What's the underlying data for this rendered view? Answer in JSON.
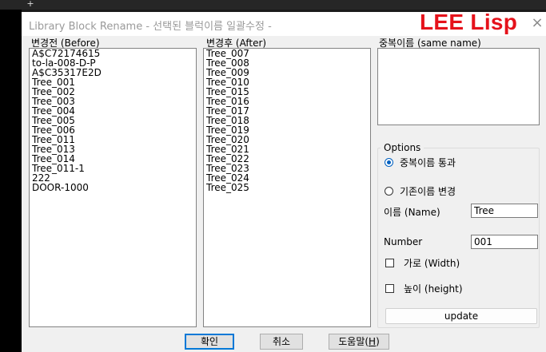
{
  "window": {
    "title": "Library Block Rename - 선택된 블럭이름 일괄수정 -",
    "brand": "LEE Lisp",
    "close_glyph": "×"
  },
  "host": {
    "new_tab_glyph": "+"
  },
  "before": {
    "label": "변경전 (Before)",
    "items": [
      "A$C72174615",
      "to-la-008-D-P",
      "A$C35317E2D",
      "Tree_001",
      "Tree_002",
      "Tree_003",
      "Tree_004",
      "Tree_005",
      "Tree_006",
      "Tree_011",
      "Tree_013",
      "Tree_014",
      "Tree_011-1",
      "222",
      "DOOR-1000"
    ]
  },
  "after": {
    "label": "변경후 (After)",
    "items": [
      "Tree_007",
      "Tree_008",
      "Tree_009",
      "Tree_010",
      "Tree_015",
      "Tree_016",
      "Tree_017",
      "Tree_018",
      "Tree_019",
      "Tree_020",
      "Tree_021",
      "Tree_022",
      "Tree_023",
      "Tree_024",
      "Tree_025"
    ]
  },
  "duplicate": {
    "label": "중복이름 (same name)",
    "items": []
  },
  "options": {
    "title": "Options",
    "radio_pass": {
      "label": "중복이름 통과",
      "selected": true
    },
    "radio_change": {
      "label": "기존이름 변경",
      "selected": false
    },
    "name_label": "이름 (Name)",
    "name_value": "Tree",
    "number_label": "Number",
    "number_value": "001",
    "width_label": "가로 (Width)",
    "width_checked": false,
    "height_label": "높이 (height)",
    "height_checked": false,
    "update_label": "update"
  },
  "buttons": {
    "ok": "확인",
    "cancel": "취소",
    "help_prefix": "도움말(",
    "help_key": "H",
    "help_suffix": ")"
  }
}
